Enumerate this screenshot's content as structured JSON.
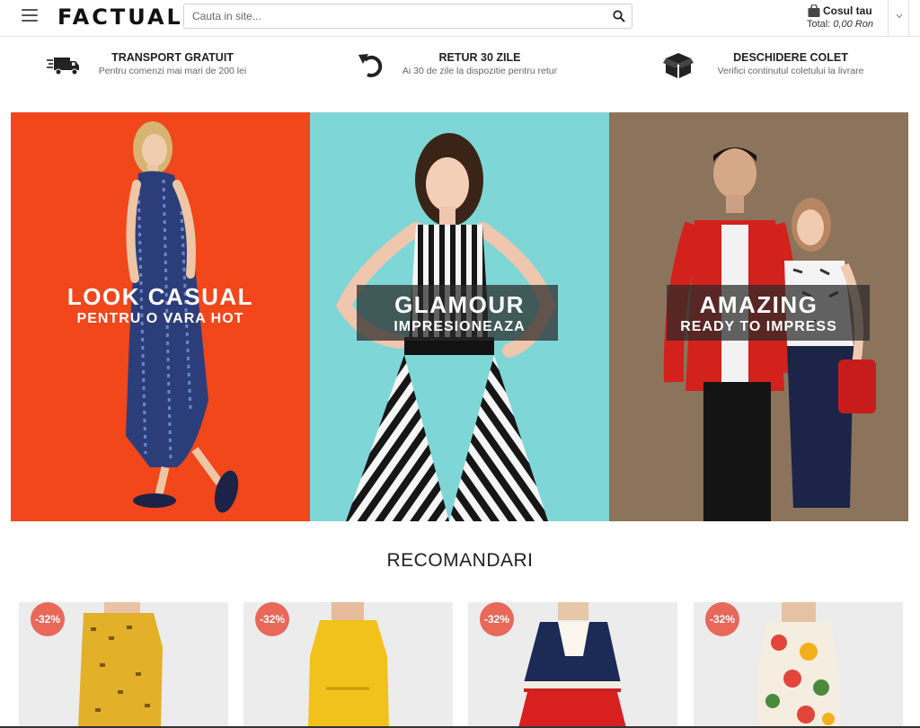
{
  "header": {
    "logo": "FACTUAL",
    "search_placeholder": "Cauta in site...",
    "cart_title": "Cosul tau",
    "cart_total_label": "Total:",
    "cart_total_value": "0,00 Ron"
  },
  "features": [
    {
      "title": "TRANSPORT GRATUIT",
      "subtitle": "Pentru comenzi mai mari de 200 lei",
      "icon": "truck-icon"
    },
    {
      "title": "RETUR 30 ZILE",
      "subtitle": "Ai 30 de zile la dispozitie pentru retur",
      "icon": "return-arrow-icon"
    },
    {
      "title": "DESCHIDERE COLET",
      "subtitle": "Verifici continutul coletului la livrare",
      "icon": "open-box-icon"
    }
  ],
  "banners": [
    {
      "title": "LOOK CASUAL",
      "subtitle": "PENTRU O VARA HOT",
      "bg": "#f2461b"
    },
    {
      "title": "GLAMOUR",
      "subtitle": "IMPRESIONEAZA",
      "bg": "#7fd6d6"
    },
    {
      "title": "AMAZING",
      "subtitle": "READY TO IMPRESS",
      "bg": "#8c735c"
    }
  ],
  "recommendations": {
    "title": "RECOMANDARI",
    "products": [
      {
        "discount": "-32%",
        "color": "#e3b02a"
      },
      {
        "discount": "-32%",
        "color": "#f2c21c"
      },
      {
        "discount": "-32%",
        "color": "#d82020"
      },
      {
        "discount": "-32%",
        "color": "#4b8a3c"
      }
    ]
  },
  "colors": {
    "badge": "#e8685a",
    "text": "#222222"
  }
}
